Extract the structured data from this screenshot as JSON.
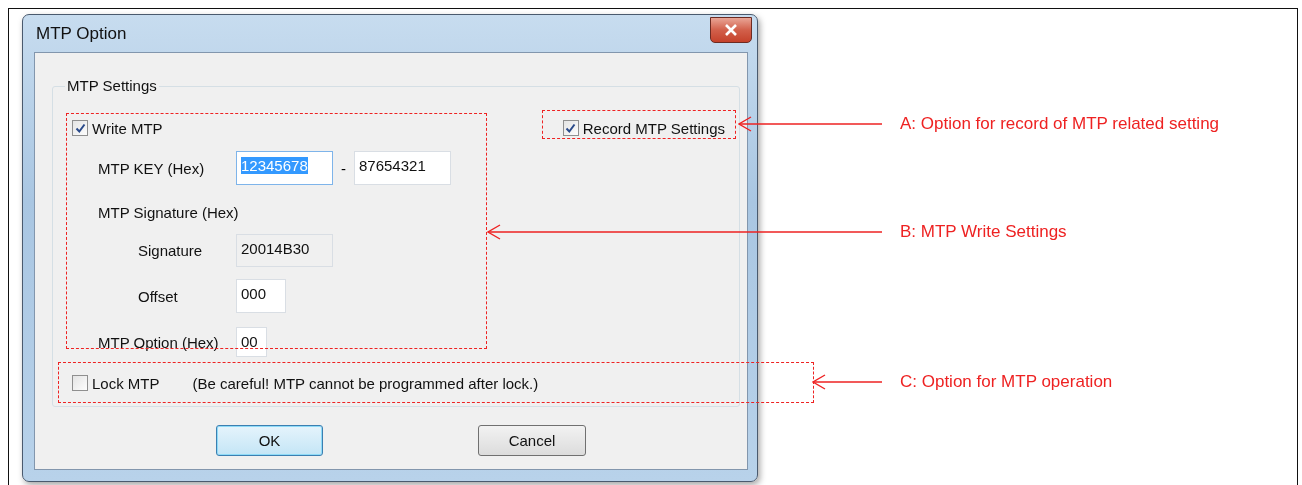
{
  "dialog": {
    "title": "MTP Option",
    "group_title": "MTP Settings",
    "write_mtp": {
      "label": "Write MTP",
      "checked": true
    },
    "record_settings": {
      "label": "Record MTP Settings",
      "checked": true
    },
    "key": {
      "label": "MTP KEY (Hex)",
      "separator": "-",
      "fields": [
        {
          "value": "12345678",
          "selected": true
        },
        {
          "value": "87654321",
          "selected": false
        }
      ]
    },
    "signature_heading": "MTP Signature (Hex)",
    "signature": {
      "label": "Signature",
      "value": "20014B30",
      "disabled": true
    },
    "offset": {
      "label": "Offset",
      "value": "000"
    },
    "option": {
      "label": "MTP Option (Hex)",
      "value": "00"
    },
    "lock": {
      "label": "Lock MTP",
      "checked": false,
      "note": "(Be careful! MTP cannot be programmed after lock.)"
    },
    "buttons": [
      {
        "label": "OK",
        "default": true
      },
      {
        "label": "Cancel",
        "default": false
      }
    ]
  },
  "callouts": [
    {
      "label": "A: Option for record of MTP related setting"
    },
    {
      "label": "B: MTP Write Settings"
    },
    {
      "label": "C: Option for MTP operation"
    }
  ]
}
